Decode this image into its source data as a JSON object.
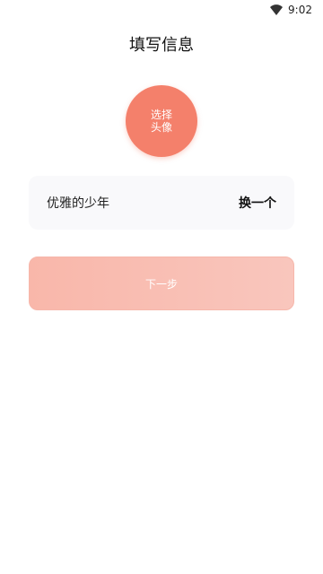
{
  "status_bar": {
    "time": "9:02",
    "wifi_icon": "wifi-icon"
  },
  "page": {
    "title": "填写信息"
  },
  "avatar": {
    "line1": "选择",
    "line2": "头像",
    "color": "#f4806b"
  },
  "nickname_row": {
    "nickname": "优雅的少年",
    "change_label": "换一个"
  },
  "next_button": {
    "label": "下一步",
    "color": "#f9b7aa"
  }
}
